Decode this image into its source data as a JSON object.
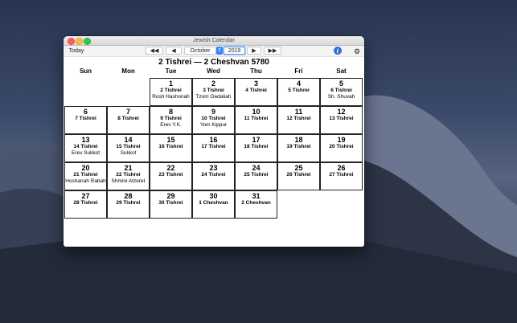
{
  "window": {
    "title": "Jewish Calendar"
  },
  "toolbar": {
    "today_label": "Today",
    "fast_back_label": "◀◀",
    "back_label": "◀",
    "month": "October",
    "stepper_label": "⇕",
    "year": "2019",
    "forward_label": "▶",
    "fast_forward_label": "▶▶",
    "info_label": "i",
    "settings_label": "⚙"
  },
  "calendar": {
    "heading": "2 Tishrei — 2 Cheshvan 5780",
    "weekdays": [
      "Sun",
      "Mon",
      "Tue",
      "Wed",
      "Thu",
      "Fri",
      "Sat"
    ],
    "days": [
      {
        "g": "1",
        "h": "2 Tishrei",
        "e": "Rosh Hashonah"
      },
      {
        "g": "2",
        "h": "3 Tishrei",
        "e": "Tzom Gedaliah"
      },
      {
        "g": "3",
        "h": "4 Tishrei",
        "e": ""
      },
      {
        "g": "4",
        "h": "5 Tishrei",
        "e": ""
      },
      {
        "g": "5",
        "h": "6 Tishrei",
        "e": "Sh. Shuvah"
      },
      {
        "g": "6",
        "h": "7 Tishrei",
        "e": ""
      },
      {
        "g": "7",
        "h": "8 Tishrei",
        "e": ""
      },
      {
        "g": "8",
        "h": "9 Tishrei",
        "e": "Erev Y.K."
      },
      {
        "g": "9",
        "h": "10 Tishrei",
        "e": "Yom Kippur"
      },
      {
        "g": "10",
        "h": "11 Tishrei",
        "e": ""
      },
      {
        "g": "11",
        "h": "12 Tishrei",
        "e": ""
      },
      {
        "g": "12",
        "h": "13 Tishrei",
        "e": ""
      },
      {
        "g": "13",
        "h": "14 Tishrei",
        "e": "Erev Sukkot"
      },
      {
        "g": "14",
        "h": "15 Tishrei",
        "e": "Sukkot"
      },
      {
        "g": "15",
        "h": "16 Tishrei",
        "e": ""
      },
      {
        "g": "16",
        "h": "17 Tishrei",
        "e": ""
      },
      {
        "g": "17",
        "h": "18 Tishrei",
        "e": ""
      },
      {
        "g": "18",
        "h": "19 Tishrei",
        "e": ""
      },
      {
        "g": "19",
        "h": "20 Tishrei",
        "e": ""
      },
      {
        "g": "20",
        "h": "21 Tishrei",
        "e": "Hoshanah Rabah"
      },
      {
        "g": "21",
        "h": "22 Tishrei",
        "e": "Shmini Atzeret"
      },
      {
        "g": "22",
        "h": "23 Tishrei",
        "e": ""
      },
      {
        "g": "23",
        "h": "24 Tishrei",
        "e": ""
      },
      {
        "g": "24",
        "h": "25 Tishrei",
        "e": ""
      },
      {
        "g": "25",
        "h": "26 Tishrei",
        "e": ""
      },
      {
        "g": "26",
        "h": "27 Tishrei",
        "e": ""
      },
      {
        "g": "27",
        "h": "28 Tishrei",
        "e": ""
      },
      {
        "g": "28",
        "h": "29 Tishrei",
        "e": ""
      },
      {
        "g": "29",
        "h": "30 Tishrei",
        "e": ""
      },
      {
        "g": "30",
        "h": "1 Cheshvan",
        "e": ""
      },
      {
        "g": "31",
        "h": "2 Cheshvan",
        "e": ""
      }
    ]
  }
}
